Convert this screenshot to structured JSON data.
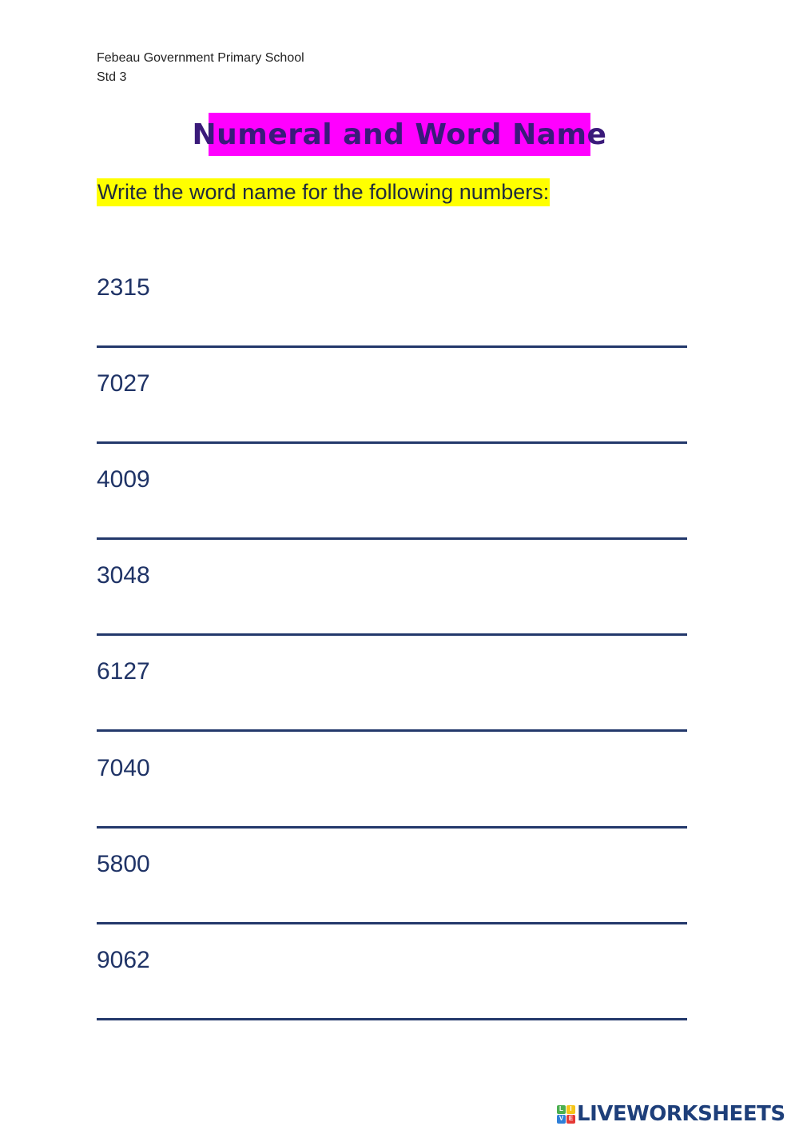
{
  "header": {
    "school": "Febeau Government Primary School",
    "grade": "Std 3"
  },
  "title": "Numeral and Word Name",
  "instruction": "Write the word name for the following numbers:",
  "colors": {
    "title_highlight": "#ff00ff",
    "instruction_highlight": "#ffff00",
    "text_navy": "#1f3366"
  },
  "items": [
    {
      "number": "2315",
      "answer": ""
    },
    {
      "number": "7027",
      "answer": ""
    },
    {
      "number": "4009",
      "answer": ""
    },
    {
      "number": "3048",
      "answer": ""
    },
    {
      "number": "6127",
      "answer": ""
    },
    {
      "number": "7040",
      "answer": ""
    },
    {
      "number": "5800",
      "answer": ""
    },
    {
      "number": "9062",
      "answer": ""
    }
  ],
  "logo": {
    "letters": [
      "L",
      "I",
      "V",
      "E"
    ],
    "text": "LIVEWORKSHEETS"
  }
}
